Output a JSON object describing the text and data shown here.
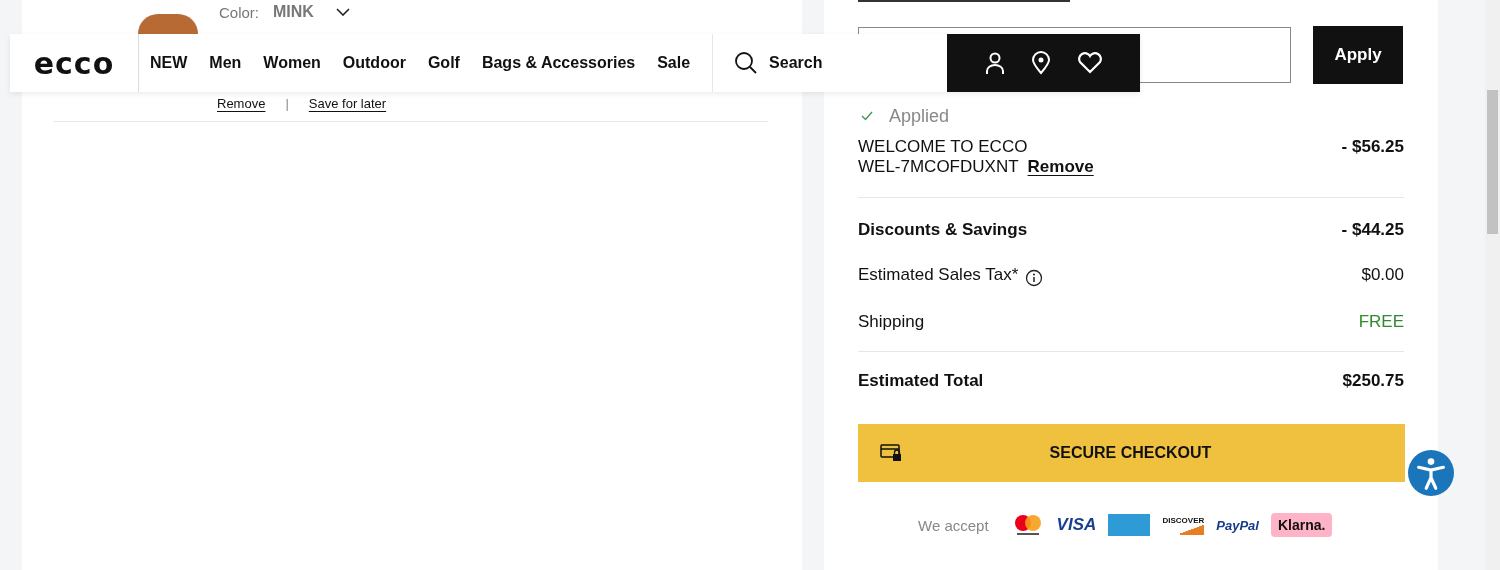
{
  "header": {
    "logo": "ecco",
    "nav": [
      {
        "label": "NEW"
      },
      {
        "label": "Men"
      },
      {
        "label": "Women"
      },
      {
        "label": "Outdoor"
      },
      {
        "label": "Golf"
      },
      {
        "label": "Bags & Accessories"
      },
      {
        "label": "Sale"
      }
    ],
    "search": {
      "label": "Search"
    }
  },
  "cart_item": {
    "color_label": "Color:",
    "color_value": "MINK",
    "actions": [
      {
        "label": "Remove"
      },
      {
        "label": "Save for later"
      }
    ],
    "separator": "|"
  },
  "summary": {
    "promo": {
      "button": "Apply",
      "status": "Applied"
    },
    "discount": {
      "name": "WELCOME TO ECCO",
      "amount": "- $56.25",
      "code": "WEL-7MCOFDUXNT",
      "remove": "Remove"
    },
    "lines": [
      {
        "kind": "bold",
        "label": "Discounts & Savings",
        "value": "- $44.25"
      },
      {
        "kind": "info",
        "label": "Estimated Sales Tax*",
        "value": "$0.00"
      },
      {
        "kind": "free",
        "label": "Shipping",
        "value": "FREE"
      }
    ],
    "total": {
      "label": "Estimated Total",
      "value": "$250.75"
    },
    "checkout": "SECURE CHECKOUT",
    "accept_label": "We accept",
    "payment_methods": [
      {
        "kind": "mastercard"
      },
      {
        "kind": "visa",
        "label": "VISA"
      },
      {
        "kind": "amex"
      },
      {
        "kind": "discover",
        "label": "DISCOVER"
      },
      {
        "kind": "paypal",
        "label": "PayPal"
      },
      {
        "kind": "klarna",
        "label": "Klarna."
      }
    ]
  }
}
